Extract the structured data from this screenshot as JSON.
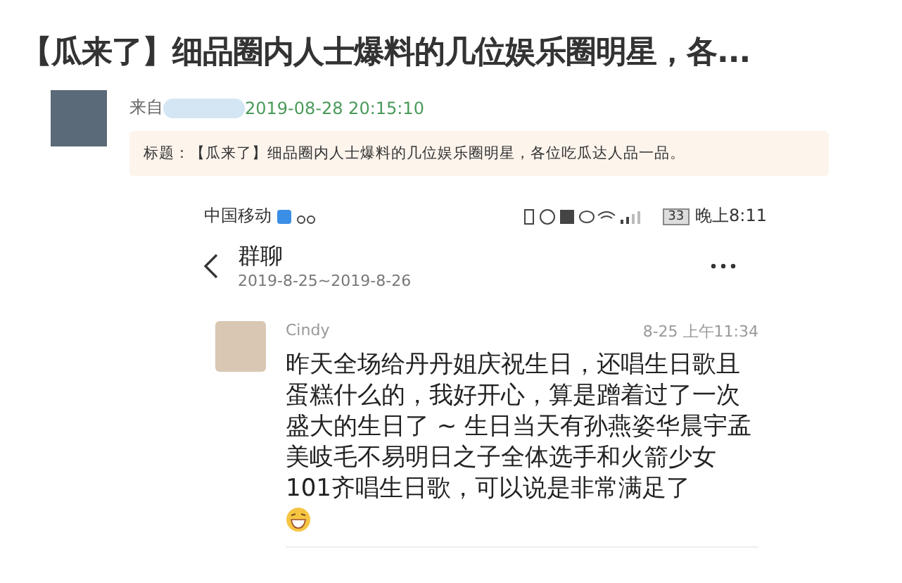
{
  "article": {
    "title": "【瓜来了】细品圈内人士爆料的几位娱乐圈明星，各...",
    "source_label": "来自",
    "date": "2019-08-28 20:15:10",
    "summary": "标题：【瓜来了】细品圈内人士爆料的几位娱乐圈明星，各位吃瓜达人品一品。"
  },
  "phone": {
    "status_bar": {
      "carrier": "中国移动",
      "battery": "33",
      "time": "晚上8:11"
    },
    "nav": {
      "title": "群聊",
      "subtitle": "2019-8-25~2019-8-26"
    },
    "message": {
      "sender": "Cindy",
      "time": "8-25 上午11:34",
      "text": "昨天全场给丹丹姐庆祝生日，还唱生日歌且蛋糕什么的，我好开心，算是蹭着过了一次盛大的生日了 ~ 生日当天有孙燕姿华晨宇孟美岐毛不易明日之子全体选手和火箭少女101齐唱生日歌，可以说是非常满足了"
    }
  }
}
